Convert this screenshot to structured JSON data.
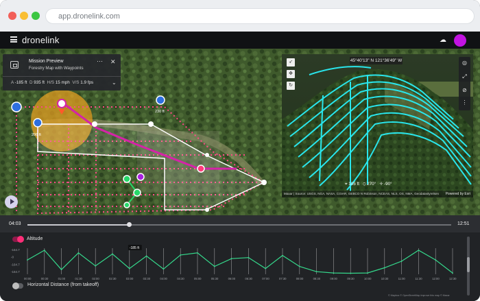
{
  "browser": {
    "url": "app.dronelink.com"
  },
  "app": {
    "brand": "dronelink",
    "menu_icon": "hamburger-menu-icon",
    "upload_icon": "cloud-upload-icon",
    "accent": "#c113e0"
  },
  "mission": {
    "title": "Mission Preview",
    "subtitle": "Forestry Map with Waypoints",
    "stats": {
      "altitude_key": "A",
      "altitude": "-185 ft",
      "distance_key": "D",
      "distance": "935 ft",
      "hspeed_key": "H/S",
      "hspeed": "15 mph",
      "vspeed_key": "V/S",
      "vspeed": "1.9 fps"
    }
  },
  "map": {
    "labels": {
      "label_a": "206 ft",
      "label_b": "230 ft"
    },
    "route_color": "#e52b8c",
    "plot_color": "#ff3c8e"
  },
  "view3d": {
    "coords": "45°40'13\" N 121°36'49\" W",
    "hud_altitude": "105 ft",
    "hud_heading": "270°",
    "hud_gimbal": "-90°",
    "attribution": "Maxar | Source: USGS, NGA, NASA, CGIAR, GEBCO N Robinson, NCEAS, NLS, OS, NMA, Geodatastyrelsen",
    "powered_by": "Powered by Esri",
    "line_color": "#29e6ec"
  },
  "timeline": {
    "start": "04:03",
    "end": "12:51",
    "progress": 0.24
  },
  "profile": {
    "altitude_label": "Altitude",
    "altitude_enabled": true,
    "distance_label": "Horizontal Distance (from takeoff)",
    "distance_enabled": false,
    "tooltip": "-185 ft",
    "y_ticks": [
      "-164.7",
      "-0",
      "-164.7",
      "-164.7"
    ],
    "x_ticks": [
      "00:00",
      "00:30",
      "01:00",
      "01:30",
      "02:00",
      "02:30",
      "03:00",
      "03:30",
      "04:00",
      "04:30",
      "05:00",
      "05:30",
      "06:00",
      "06:30",
      "07:00",
      "07:30",
      "08:00",
      "08:30",
      "09:00",
      "09:30",
      "10:00",
      "10:30",
      "11:00",
      "11:30",
      "12:00",
      "12:30"
    ],
    "credit": "© Mapbox © OpenStreetMap Improve this map © Maxar",
    "line_color": "#35d98c"
  },
  "chart_data": {
    "type": "line",
    "x": [
      "00:00",
      "00:30",
      "01:00",
      "01:30",
      "02:00",
      "02:30",
      "03:00",
      "03:30",
      "04:00",
      "04:30",
      "05:00",
      "05:30",
      "06:00",
      "06:30",
      "07:00",
      "07:30",
      "08:00",
      "08:30",
      "09:00",
      "09:30",
      "10:00",
      "10:30",
      "11:00",
      "11:30",
      "12:00",
      "12:30"
    ],
    "series": [
      {
        "name": "Altitude",
        "values": [
          0.55,
          0.92,
          0.18,
          0.82,
          0.32,
          0.78,
          0.22,
          0.7,
          0.2,
          0.74,
          0.82,
          0.3,
          0.6,
          0.64,
          0.22,
          0.72,
          0.3,
          0.1,
          0.05,
          0.04,
          0.05,
          0.25,
          0.5,
          0.92,
          0.55,
          0.05
        ]
      }
    ],
    "xlabel": "",
    "ylabel": "",
    "ylim": [
      0,
      1
    ]
  }
}
